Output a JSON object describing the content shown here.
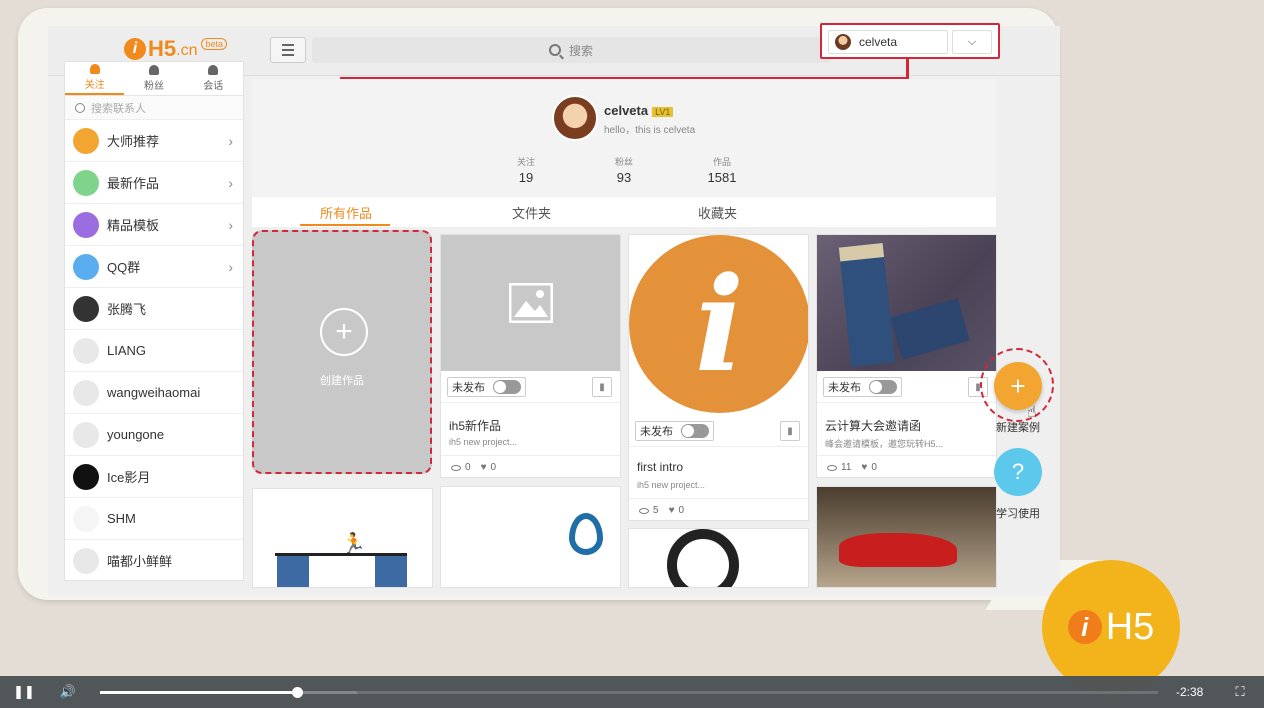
{
  "app": {
    "logo_main": "H5",
    "logo_suffix": ".cn",
    "logo_badge": "beta",
    "search_placeholder": "搜索",
    "username": "celveta"
  },
  "sidebar": {
    "tabs": [
      {
        "label": "关注",
        "active": true
      },
      {
        "label": "粉丝",
        "active": false
      },
      {
        "label": "会话",
        "active": false
      }
    ],
    "search_placeholder": "搜索联系人",
    "items": [
      {
        "label": "大师推荐",
        "icon": "thumbs-up-icon",
        "color": "#f2a531",
        "chevron": true
      },
      {
        "label": "最新作品",
        "icon": "sparkle-icon",
        "color": "#7fd48c",
        "chevron": true
      },
      {
        "label": "精品模板",
        "icon": "layers-icon",
        "color": "#9a6ee0",
        "chevron": true
      },
      {
        "label": "QQ群",
        "icon": "qq-icon",
        "color": "#5aaef0",
        "chevron": true
      },
      {
        "label": "张腾飞",
        "icon": "avatar-icon",
        "color": "#333333",
        "chevron": false
      },
      {
        "label": "LIANG",
        "icon": "default-avatar-icon",
        "color": "#e8e8e8",
        "chevron": false
      },
      {
        "label": "wangweihaomai",
        "icon": "default-avatar-icon",
        "color": "#e8e8e8",
        "chevron": false
      },
      {
        "label": "youngone",
        "icon": "default-avatar-icon",
        "color": "#e8e8e8",
        "chevron": false
      },
      {
        "label": "Ice影月",
        "icon": "avatar-icon",
        "color": "#111111",
        "chevron": false
      },
      {
        "label": "SHM",
        "icon": "avatar-icon",
        "color": "#f5f5f5",
        "chevron": false
      },
      {
        "label": "喵都小鲜鲜",
        "icon": "default-avatar-icon",
        "color": "#e8e8e8",
        "chevron": false
      }
    ]
  },
  "profile": {
    "name": "celveta",
    "level": "LV1",
    "bio": "hello，this is celveta",
    "stats": [
      {
        "label": "关注",
        "value": "19"
      },
      {
        "label": "粉丝",
        "value": "93"
      },
      {
        "label": "作品",
        "value": "1581"
      }
    ],
    "tabs": [
      {
        "label": "所有作品",
        "active": true
      },
      {
        "label": "文件夹",
        "active": false
      },
      {
        "label": "收藏夹",
        "active": false
      }
    ]
  },
  "create_card": {
    "label": "创建作品"
  },
  "cards": [
    {
      "status": "未发布",
      "title": "ih5新作品",
      "subtitle": "ih5 new project...",
      "views": "0",
      "likes": "0"
    },
    {
      "status": "未发布",
      "title": "first intro",
      "subtitle": "ih5 new project...",
      "views": "5",
      "likes": "0"
    },
    {
      "status": "未发布",
      "title": "云计算大会邀请函",
      "subtitle": "峰会邀请模板，邀您玩转H5...",
      "views": "11",
      "likes": "0"
    }
  ],
  "fabs": {
    "new_label": "新建案例",
    "help_label": "学习使用"
  },
  "brand_badge": "H5",
  "video": {
    "time_remaining": "-2:38",
    "progress_fraction": 0.186,
    "buffered_fraction": 0.243
  },
  "colors": {
    "accent": "#f08a1c",
    "highlight": "#d2263a",
    "help": "#5bc8ec"
  }
}
